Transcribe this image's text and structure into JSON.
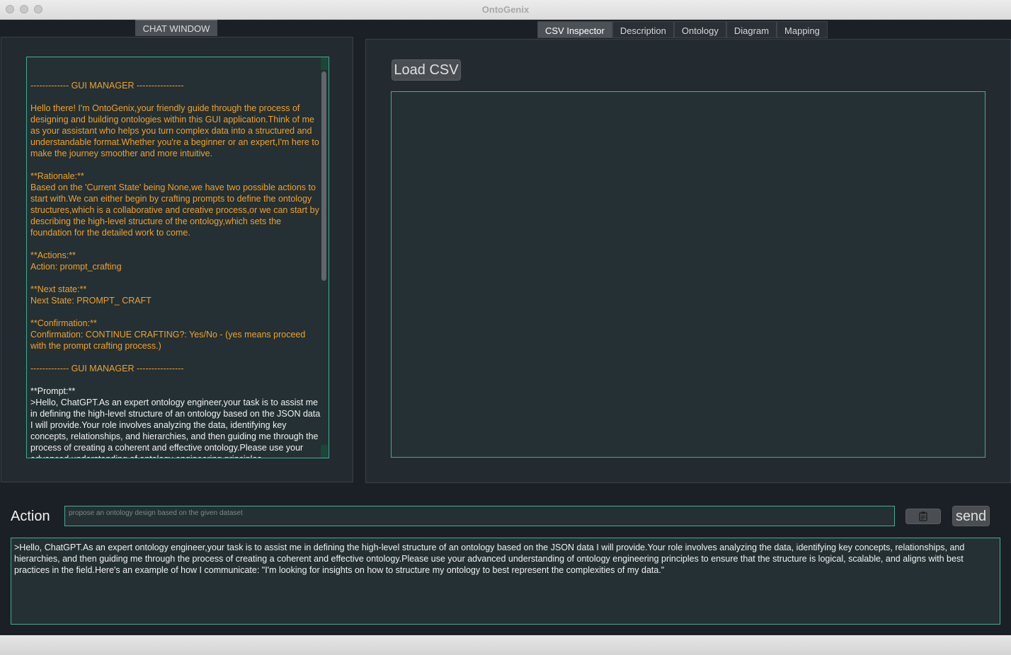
{
  "window": {
    "title": "OntoGenix"
  },
  "chat": {
    "tab_label": "CHAT WINDOW",
    "lines": [
      {
        "text": "------------- GUI MANAGER ----------------",
        "color": "orange"
      },
      {
        "text": "",
        "color": "orange"
      },
      {
        "text": "Hello there! I'm OntoGenix,your friendly guide through the process of designing and building ontologies within this GUI application.Think of me as your assistant who helps you turn complex data into a structured and understandable format.Whether you're a beginner or an expert,I'm here to make the journey smoother and more intuitive.",
        "color": "orange"
      },
      {
        "text": "",
        "color": "orange"
      },
      {
        "text": "**Rationale:**",
        "color": "orange"
      },
      {
        "text": "Based on the 'Current State' being None,we have two possible actions to start with.We can either begin by crafting prompts to define the ontology structures,which is a collaborative and creative process,or we can start by describing the high-level structure of the ontology,which sets the foundation for the detailed work to come.",
        "color": "orange"
      },
      {
        "text": "",
        "color": "orange"
      },
      {
        "text": "**Actions:**",
        "color": "orange"
      },
      {
        "text": "Action: prompt_crafting",
        "color": "orange"
      },
      {
        "text": "",
        "color": "orange"
      },
      {
        "text": "**Next state:**",
        "color": "orange"
      },
      {
        "text": "Next State: PROMPT_ CRAFT",
        "color": "orange"
      },
      {
        "text": "",
        "color": "orange"
      },
      {
        "text": "**Confirmation:**",
        "color": "orange"
      },
      {
        "text": "Confirmation: CONTINUE CRAFTING?: Yes/No - (yes means proceed with the prompt crafting process.)",
        "color": "orange"
      },
      {
        "text": "",
        "color": "orange"
      },
      {
        "text": "------------- GUI MANAGER ----------------",
        "color": "orange"
      },
      {
        "text": "",
        "color": "white"
      },
      {
        "text": "**Prompt:**",
        "color": "white"
      },
      {
        "text": ">Hello, ChatGPT.As an expert ontology engineer,your task is to assist me in defining the high-level structure of an ontology based on the JSON data I will provide.Your role involves analyzing the data, identifying key concepts, relationships, and hierarchies, and then guiding me through the process of creating a coherent and effective ontology.Please use your advanced understanding of ontology engineering principles.",
        "color": "white"
      }
    ]
  },
  "tabs": [
    "CSV Inspector",
    "Description",
    "Ontology",
    "Diagram",
    "Mapping"
  ],
  "active_tab": 0,
  "csv": {
    "load_label": "Load CSV"
  },
  "action": {
    "label": "Action",
    "placeholder": "propose an ontology design based on the given dataset",
    "send_label": "send",
    "clipboard_icon": "clipboard-icon"
  },
  "output": {
    "text": ">Hello, ChatGPT.As an expert ontology engineer,your task is to assist me in defining the high-level structure of an ontology based on the JSON data I will provide.Your role involves analyzing the data, identifying key concepts, relationships, and hierarchies, and then guiding me through the process of creating a coherent and effective ontology.Please use your advanced understanding of ontology engineering principles to ensure that the structure is logical, scalable, and aligns with best practices in the field.Here's an example of how I communicate: \"I'm looking for insights on how to structure my ontology to best represent the complexities of my data.\""
  },
  "colors": {
    "accent": "#3fae97",
    "orange_text": "#f1a12b",
    "panel": "#232a30",
    "field": "#243033"
  }
}
